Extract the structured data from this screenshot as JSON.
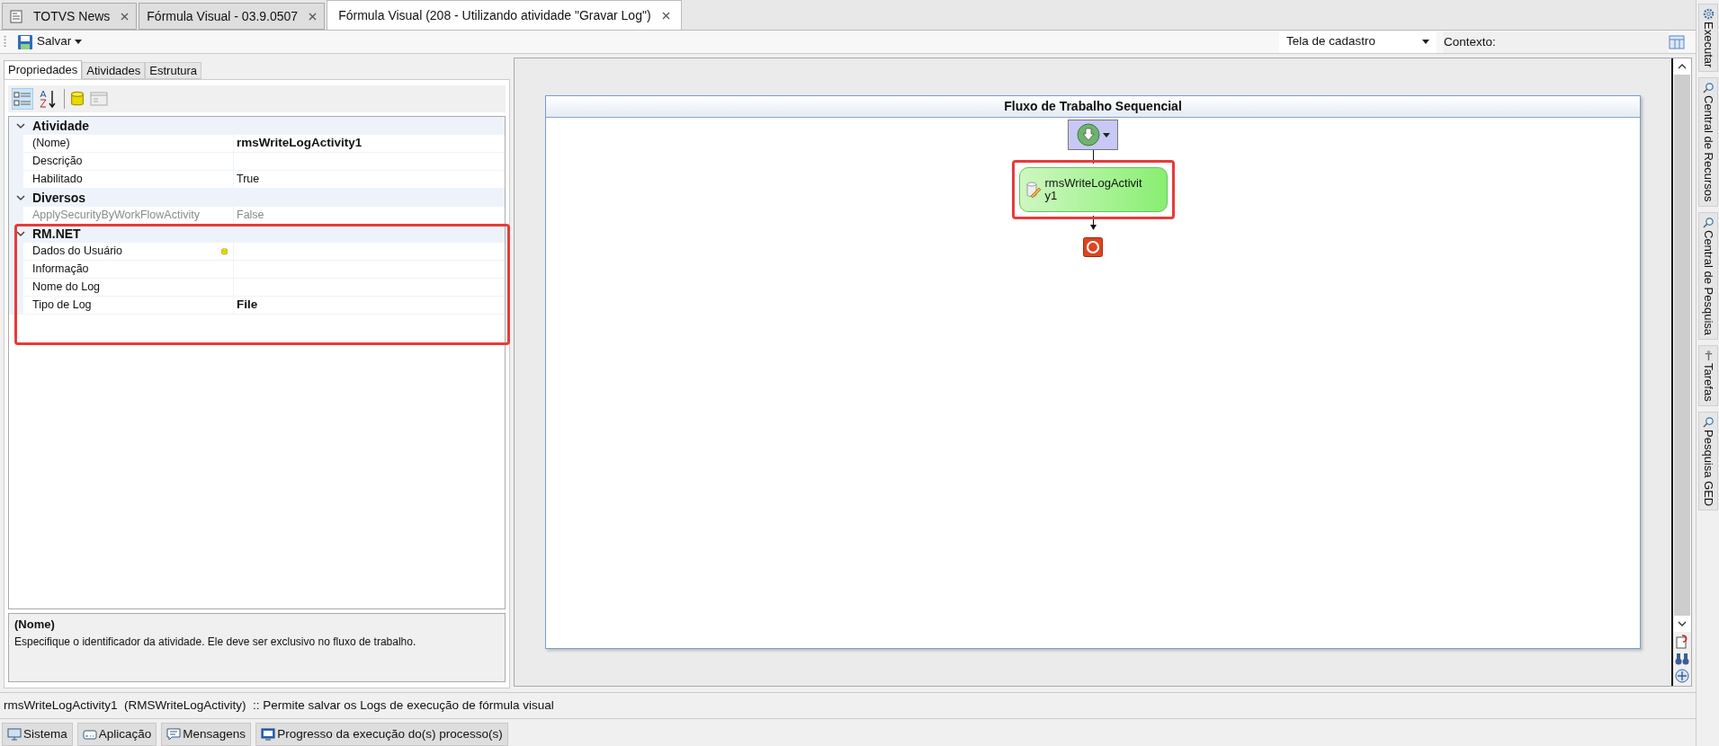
{
  "document_tabs": [
    {
      "label": "TOTVS News",
      "selected": false,
      "kind": "news"
    },
    {
      "label": "Fórmula Visual - 03.9.0507",
      "selected": false,
      "kind": "plain"
    },
    {
      "label": "Fórmula Visual (208 - Utilizando atividade \"Gravar Log\")",
      "selected": true,
      "kind": "plain"
    }
  ],
  "toolbar": {
    "save_label": "Salvar",
    "screen_select": {
      "value": "Tela de cadastro"
    },
    "context_label": "Contexto:"
  },
  "left_panel": {
    "tabs": [
      {
        "label": "Propriedades",
        "selected": true
      },
      {
        "label": "Atividades",
        "selected": false
      },
      {
        "label": "Estrutura",
        "selected": false
      }
    ],
    "grid_toolbar": {
      "categorized_selected": true
    },
    "categories": [
      {
        "name": "Atividade",
        "expanded": true,
        "highlighted": false,
        "properties": [
          {
            "name": "(Nome)",
            "value": "rmsWriteLogActivity1",
            "modified": true,
            "disabled": false,
            "kind": "text"
          },
          {
            "name": "Descrição",
            "disabled": false,
            "kind": "text"
          },
          {
            "name": "Habilitado",
            "value": "True",
            "modified": false,
            "disabled": false,
            "kind": "text"
          }
        ]
      },
      {
        "name": "Diversos",
        "expanded": true,
        "highlighted": false,
        "properties": [
          {
            "name": "ApplySecurityByWorkFlowActivity",
            "value": "False",
            "modified": false,
            "disabled": true,
            "kind": "text"
          }
        ]
      },
      {
        "name": "RM.NET",
        "expanded": true,
        "highlighted": true,
        "properties": [
          {
            "name": "Dados do Usuário",
            "disabled": false,
            "kind": "database"
          },
          {
            "name": "Informação",
            "disabled": false,
            "kind": "text"
          },
          {
            "name": "Nome do Log",
            "disabled": false,
            "kind": "text"
          },
          {
            "name": "Tipo de Log",
            "value": "File",
            "modified": true,
            "disabled": false,
            "kind": "text"
          }
        ]
      }
    ],
    "description": {
      "title": "(Nome)",
      "text": "Especifique o identificador da atividade. Ele deve ser exclusivo no fluxo de trabalho."
    }
  },
  "designer": {
    "title": "Fluxo de Trabalho Sequencial",
    "activity": {
      "label": "rmsWriteLogActivity1",
      "highlighted": true
    }
  },
  "right_sidebar": [
    {
      "label": "Executar",
      "kind": "gear"
    },
    {
      "label": "Central de Recursos",
      "kind": "search"
    },
    {
      "label": "Central de Pesquisa",
      "kind": "search"
    },
    {
      "label": "Tarefas",
      "kind": "pin"
    },
    {
      "label": "Pesquisa GED",
      "kind": "search"
    }
  ],
  "status_text": "rmsWriteLogActivity1  (RMSWriteLogActivity)  :: Permite salvar os Logs de execução de fórmula visual",
  "bottom_tabs": [
    {
      "label": "Sistema",
      "kind": "monitor"
    },
    {
      "label": "Aplicação",
      "kind": "app"
    },
    {
      "label": "Mensagens",
      "kind": "message"
    },
    {
      "label": "Progresso da execução do(s) processo(s)",
      "kind": "progress"
    }
  ]
}
